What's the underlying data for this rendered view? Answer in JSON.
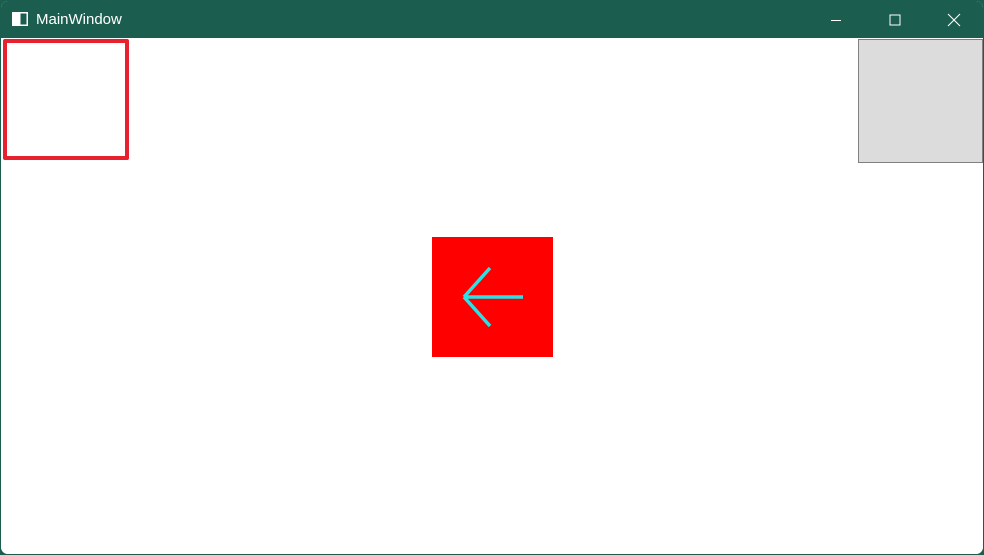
{
  "window": {
    "title": "MainWindow",
    "title_bar_color": "#1b5e4f"
  },
  "title_bar": {
    "icon": "app-window-icon",
    "controls": [
      {
        "name": "minimize",
        "icon": "minimize-icon"
      },
      {
        "name": "maximize",
        "icon": "maximize-icon"
      },
      {
        "name": "close",
        "icon": "close-icon"
      }
    ]
  },
  "content": {
    "selection_frame": {
      "color": "#e8212f"
    },
    "gray_panel": {
      "color": "#dcdcdc",
      "border_color": "#808080"
    },
    "back_button": {
      "icon": "arrow-left-icon",
      "background": "#ff0000",
      "arrow_color": "#27e3e8"
    }
  }
}
